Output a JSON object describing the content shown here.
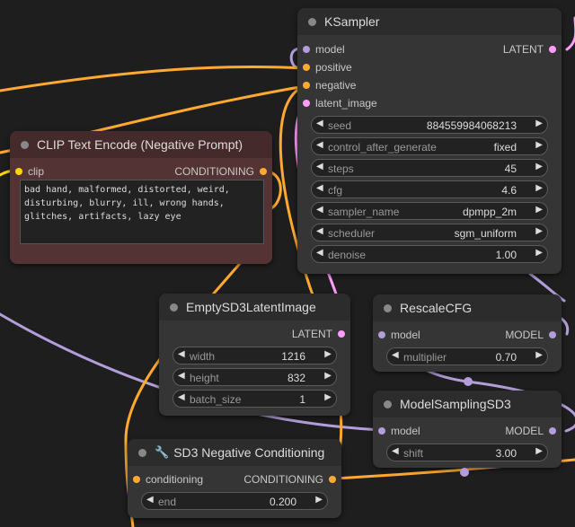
{
  "colors": {
    "background": "#1e1e1e",
    "node_bg": "#353535",
    "clip_node_bg": "#533333",
    "wire_conditioning": "#ffa931",
    "wire_latent": "#ff9cf9",
    "wire_model": "#b39ddb",
    "wire_clip": "#ffd500"
  },
  "ksampler": {
    "title": "KSampler",
    "inputs": [
      "model",
      "positive",
      "negative",
      "latent_image"
    ],
    "output": "LATENT",
    "widgets": [
      {
        "label": "seed",
        "value": "884559984068213"
      },
      {
        "label": "control_after_generate",
        "value": "fixed"
      },
      {
        "label": "steps",
        "value": "45"
      },
      {
        "label": "cfg",
        "value": "4.6"
      },
      {
        "label": "sampler_name",
        "value": "dpmpp_2m"
      },
      {
        "label": "scheduler",
        "value": "sgm_uniform"
      },
      {
        "label": "denoise",
        "value": "1.00"
      }
    ]
  },
  "clip": {
    "title": "CLIP Text Encode (Negative Prompt)",
    "input": "clip",
    "output": "CONDITIONING",
    "text": "bad hand, malformed, distorted, weird,\ndisturbing, blurry, ill, wrong hands,\nglitches, artifacts, lazy eye"
  },
  "empty_latent": {
    "title": "EmptySD3LatentImage",
    "output": "LATENT",
    "widgets": [
      {
        "label": "width",
        "value": "1216"
      },
      {
        "label": "height",
        "value": "832"
      },
      {
        "label": "batch_size",
        "value": "1"
      }
    ]
  },
  "rescale_cfg": {
    "title": "RescaleCFG",
    "input": "model",
    "output": "MODEL",
    "widgets": [
      {
        "label": "multiplier",
        "value": "0.70"
      }
    ]
  },
  "model_sampling": {
    "title": "ModelSamplingSD3",
    "input": "model",
    "output": "MODEL",
    "widgets": [
      {
        "label": "shift",
        "value": "3.00"
      }
    ]
  },
  "sd3_neg": {
    "title": "SD3 Negative Conditioning",
    "icon": "wrench-icon",
    "input": "conditioning",
    "output": "CONDITIONING",
    "widgets": [
      {
        "label": "end",
        "value": "0.200"
      }
    ]
  }
}
